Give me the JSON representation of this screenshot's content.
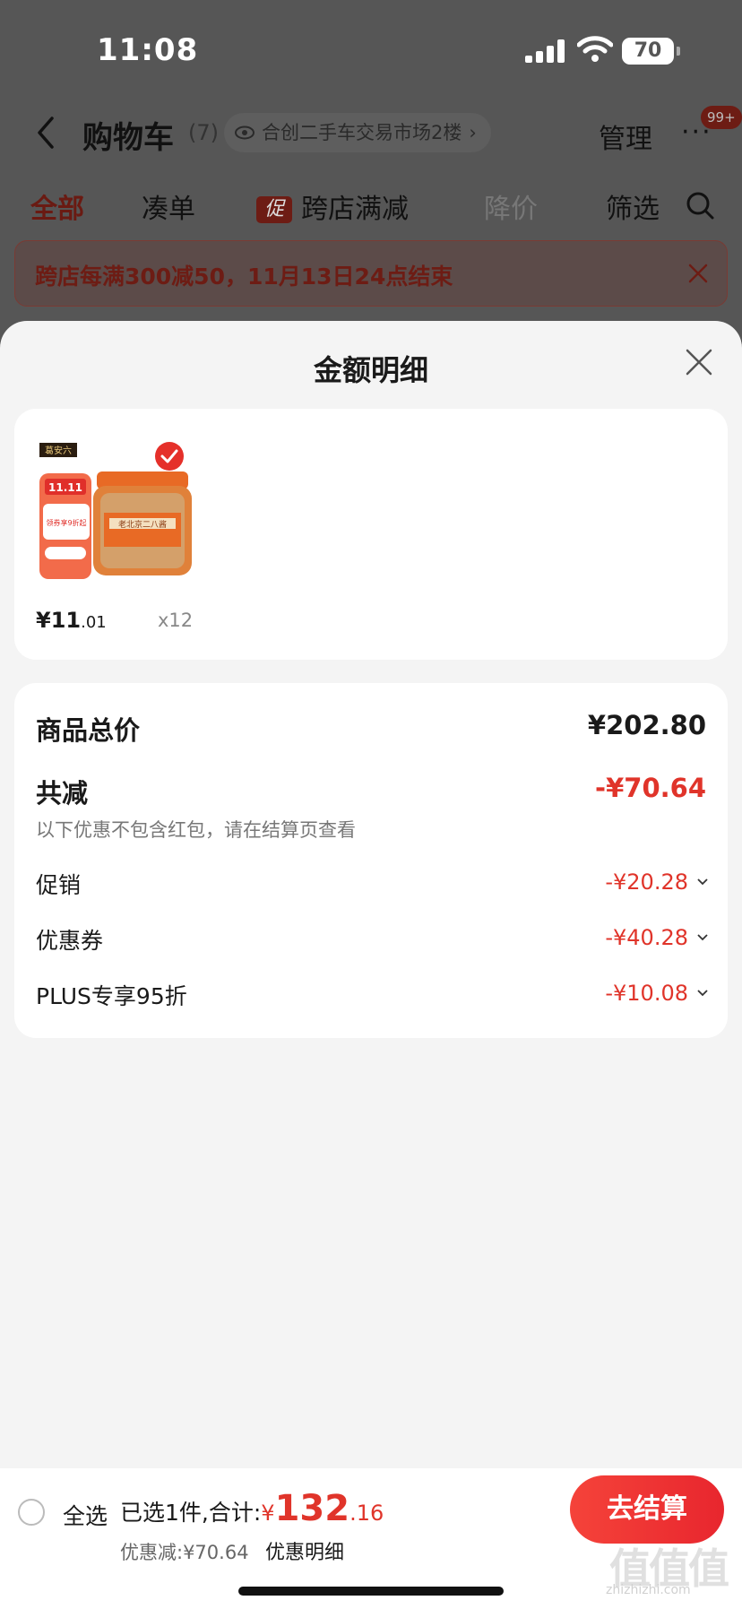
{
  "status_bar": {
    "time": "11:08",
    "battery": "70"
  },
  "nav": {
    "title": "购物车",
    "count": "(7)",
    "location": "合创二手车交易市场2楼",
    "manage": "管理",
    "badge": "99+"
  },
  "tabs": [
    {
      "label": "全部"
    },
    {
      "label": "凑单"
    },
    {
      "label": "跨店满减",
      "tag": "促"
    },
    {
      "label": "降价"
    },
    {
      "label": "筛选"
    }
  ],
  "banner": {
    "text": "跨店每满300减50，11月13日24点结束"
  },
  "sheet": {
    "title": "金额明细",
    "product": {
      "price_main": "¥11",
      "price_dec": ".01",
      "qty": "x12",
      "img_brand": "葛安六",
      "img_tag": "11.11",
      "img_text": "领券享9折起",
      "img_jar_label": "老北京二八酱"
    },
    "total_label": "商品总价",
    "total_value": "¥202.80",
    "reduce_label": "共减",
    "reduce_value": "-¥70.64",
    "note": "以下优惠不包含红包，请在结算页查看",
    "items": [
      {
        "label": "促销",
        "value": "-¥20.28"
      },
      {
        "label": "优惠券",
        "value": "-¥40.28"
      },
      {
        "label": "PLUS专享95折",
        "value": "-¥10.08"
      }
    ]
  },
  "bottom": {
    "select_all": "全选",
    "selected_prefix": "已选1件,合计:",
    "currency": "¥",
    "amount_int": "132",
    "amount_dec": ".16",
    "discount": "优惠减:¥70.64",
    "detail_link": "优惠明细",
    "checkout": "去结算",
    "watermark": "值值值",
    "watermark_sub": "zhizhizhi.com"
  },
  "colors": {
    "accent": "#e0342a",
    "sheet_bg": "#f4f4f4",
    "overlay": "#565656"
  }
}
